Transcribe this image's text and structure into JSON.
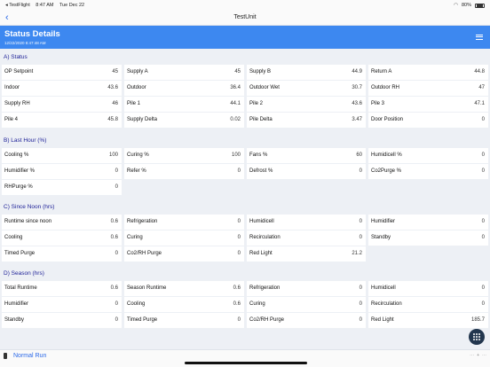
{
  "status_bar": {
    "carrier": "◂ TestFlight",
    "time": "8:47 AM",
    "date": "Tue Dec 22",
    "battery": "80%"
  },
  "nav": {
    "back_glyph": "‹",
    "title": "TestUnit"
  },
  "header": {
    "title": "Status Details",
    "subtitle": "12/22/2020 8:47:48 AM"
  },
  "sections": [
    {
      "title": "A) Status",
      "rows": [
        [
          {
            "label": "OP Setpoint",
            "value": "45"
          },
          {
            "label": "Supply A",
            "value": "45"
          },
          {
            "label": "Supply B",
            "value": "44.9"
          },
          {
            "label": "Return A",
            "value": "44.8"
          }
        ],
        [
          {
            "label": "Indoor",
            "value": "43.6"
          },
          {
            "label": "Outdoor",
            "value": "36.4"
          },
          {
            "label": "Outdoor Wet",
            "value": "30.7"
          },
          {
            "label": "Outdoor RH",
            "value": "47"
          }
        ],
        [
          {
            "label": "Supply RH",
            "value": "46"
          },
          {
            "label": "Pile 1",
            "value": "44.1"
          },
          {
            "label": "Pile 2",
            "value": "43.6"
          },
          {
            "label": "Pile 3",
            "value": "47.1"
          }
        ],
        [
          {
            "label": "Pile 4",
            "value": "45.8"
          },
          {
            "label": "Supply Delta",
            "value": "0.02"
          },
          {
            "label": "Pile Delta",
            "value": "3.47"
          },
          {
            "label": "Door Position",
            "value": "0"
          }
        ]
      ]
    },
    {
      "title": "B) Last Hour (%)",
      "rows": [
        [
          {
            "label": "Cooling %",
            "value": "100"
          },
          {
            "label": "Curing %",
            "value": "100"
          },
          {
            "label": "Fans %",
            "value": "60"
          },
          {
            "label": "Humidicell %",
            "value": "0"
          }
        ],
        [
          {
            "label": "Humidifier %",
            "value": "0"
          },
          {
            "label": "Refer %",
            "value": "0"
          },
          {
            "label": "Defrost %",
            "value": "0"
          },
          {
            "label": "Co2Purge %",
            "value": "0"
          }
        ],
        [
          {
            "label": "RHPurge %",
            "value": "0"
          }
        ]
      ]
    },
    {
      "title": "C) Since Noon (hrs)",
      "rows": [
        [
          {
            "label": "Runtime since noon",
            "value": "0.6"
          },
          {
            "label": "Refrigeration",
            "value": "0"
          },
          {
            "label": "Humidicell",
            "value": "0"
          },
          {
            "label": "Humidifier",
            "value": "0"
          }
        ],
        [
          {
            "label": "Cooling",
            "value": "0.6"
          },
          {
            "label": "Curing",
            "value": "0"
          },
          {
            "label": "Recirculation",
            "value": "0"
          },
          {
            "label": "Standby",
            "value": "0"
          }
        ],
        [
          {
            "label": "Timed Purge",
            "value": "0"
          },
          {
            "label": "Co2/RH Purge",
            "value": "0"
          },
          {
            "label": "Red Light",
            "value": "21.2"
          }
        ]
      ]
    },
    {
      "title": "D) Season (hrs)",
      "rows": [
        [
          {
            "label": "Total Runtime",
            "value": "0.6"
          },
          {
            "label": "Season Runtime",
            "value": "0.6"
          },
          {
            "label": "Refrigeration",
            "value": "0"
          },
          {
            "label": "Humidicell",
            "value": "0"
          }
        ],
        [
          {
            "label": "Humidifier",
            "value": "0"
          },
          {
            "label": "Cooling",
            "value": "0.6"
          },
          {
            "label": "Curing",
            "value": "0"
          },
          {
            "label": "Recirculation",
            "value": "0"
          }
        ],
        [
          {
            "label": "Standby",
            "value": "0"
          },
          {
            "label": "Timed Purge",
            "value": "0"
          },
          {
            "label": "Co2/RH Purge",
            "value": "0"
          },
          {
            "label": "Red Light",
            "value": "185.7"
          }
        ]
      ]
    }
  ],
  "bottom": {
    "run_label": "Normal Run"
  },
  "icons": {
    "back": "chevron-left-icon",
    "menu": "hamburger-menu-icon",
    "fab": "grid-icon",
    "run": "mode-icon"
  },
  "colors": {
    "accent": "#3d88f0",
    "section_title": "#1b1e96",
    "link": "#2a68e8",
    "fab": "#22364e"
  }
}
